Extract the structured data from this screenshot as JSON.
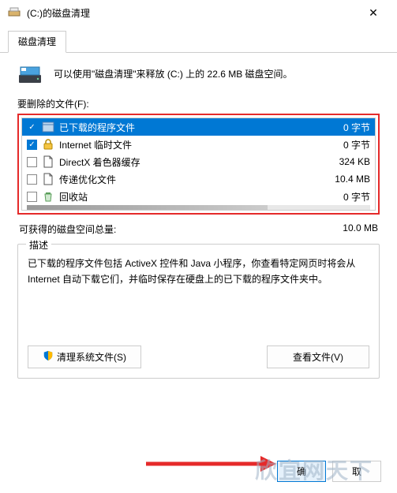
{
  "titlebar": {
    "title": "(C:)的磁盘清理"
  },
  "tab": {
    "label": "磁盘清理"
  },
  "intro": {
    "text": "可以使用\"磁盘清理\"来释放  (C:) 上的 22.6 MB 磁盘空间。"
  },
  "files_label": "要删除的文件(F):",
  "files": [
    {
      "name": "已下载的程序文件",
      "size": "0 字节",
      "checked": true,
      "selected": true,
      "icon": "window"
    },
    {
      "name": "Internet 临时文件",
      "size": "0 字节",
      "checked": true,
      "selected": false,
      "icon": "lock"
    },
    {
      "name": "DirectX 着色器缓存",
      "size": "324 KB",
      "checked": false,
      "selected": false,
      "icon": "file"
    },
    {
      "name": "传递优化文件",
      "size": "10.4 MB",
      "checked": false,
      "selected": false,
      "icon": "file"
    },
    {
      "name": "回收站",
      "size": "0 字节",
      "checked": false,
      "selected": false,
      "icon": "recycle"
    }
  ],
  "total": {
    "label": "可获得的磁盘空间总量:",
    "value": "10.0 MB"
  },
  "desc": {
    "group_label": "描述",
    "text": "已下载的程序文件包括 ActiveX 控件和 Java 小程序，你查看特定网页时将会从 Internet 自动下载它们，并临时保存在硬盘上的已下载的程序文件夹中。"
  },
  "buttons": {
    "clean_system": "清理系统文件(S)",
    "view_files": "查看文件(V)",
    "ok": "确",
    "cancel": "取"
  },
  "watermark": "欣宜网天下"
}
